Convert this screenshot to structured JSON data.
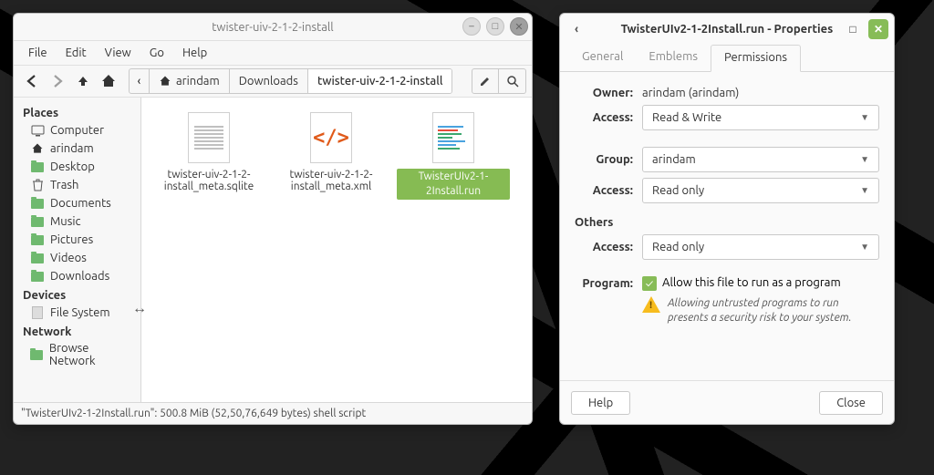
{
  "fm": {
    "title": "twister-uiv-2-1-2-install",
    "menubar": [
      "File",
      "Edit",
      "View",
      "Go",
      "Help"
    ],
    "path": {
      "segments": [
        {
          "label": "arindam",
          "home": true
        },
        {
          "label": "Downloads"
        },
        {
          "label": "twister-uiv-2-1-2-install",
          "active": true
        }
      ]
    },
    "sidebar": {
      "places_head": "Places",
      "places": [
        {
          "label": "Computer",
          "icon": "monitor"
        },
        {
          "label": "arindam",
          "icon": "home"
        },
        {
          "label": "Desktop",
          "icon": "folder"
        },
        {
          "label": "Trash",
          "icon": "trash"
        },
        {
          "label": "Documents",
          "icon": "folder"
        },
        {
          "label": "Music",
          "icon": "folder"
        },
        {
          "label": "Pictures",
          "icon": "folder"
        },
        {
          "label": "Videos",
          "icon": "folder"
        },
        {
          "label": "Downloads",
          "icon": "folder"
        }
      ],
      "devices_head": "Devices",
      "devices": [
        {
          "label": "File System",
          "icon": "drive"
        }
      ],
      "network_head": "Network",
      "network": [
        {
          "label": "Browse Network",
          "icon": "folder"
        }
      ]
    },
    "files": [
      {
        "name": "twister-uiv-2-1-2-install_meta.sqlite",
        "type": "doc"
      },
      {
        "name": "twister-uiv-2-1-2-install_meta.xml",
        "type": "xml"
      },
      {
        "name": "TwisterUIv2-1-2Install.run",
        "type": "run",
        "selected": true
      }
    ],
    "status": "\"TwisterUIv2-1-2Install.run\": 500.8 MiB (52,50,76,649 bytes) shell script"
  },
  "props": {
    "title": "TwisterUIv2-1-2Install.run - Properties",
    "tabs": [
      {
        "label": "General"
      },
      {
        "label": "Emblems"
      },
      {
        "label": "Permissions",
        "active": true
      }
    ],
    "owner_label": "Owner:",
    "owner_value": "arindam (arindam)",
    "access_label": "Access:",
    "owner_access": "Read & Write",
    "group_label": "Group:",
    "group_value": "arindam",
    "group_access": "Read only",
    "others_label": "Others",
    "others_access": "Read only",
    "program_label": "Program:",
    "program_checkbox": "Allow this file to run as a program",
    "program_checked": true,
    "warning": "Allowing untrusted programs to run presents a security risk to your system.",
    "help_btn": "Help",
    "close_btn": "Close"
  }
}
